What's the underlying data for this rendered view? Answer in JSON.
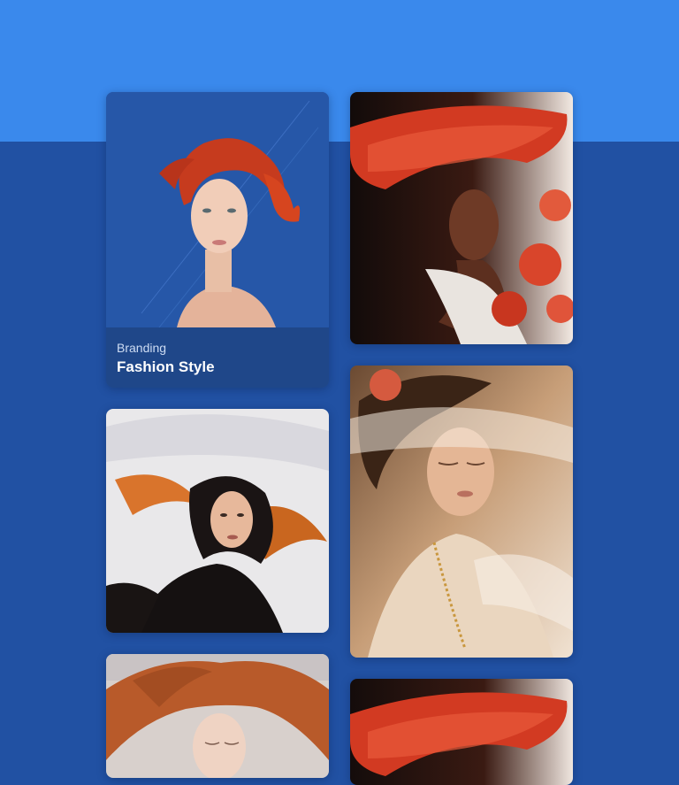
{
  "hero_card": {
    "category": "Branding",
    "title": "Fashion Style"
  },
  "gallery": [
    {
      "subject": "woman with windswept red hair on blue background"
    },
    {
      "subject": "woman in wide red hat holding red roses"
    },
    {
      "subject": "woman with flowing dark hair and white veil"
    },
    {
      "subject": "woman with closed eyes under sheer veil in warm light"
    },
    {
      "subject": "woman with windswept auburn hair"
    },
    {
      "subject": "woman in wide red hat (repeat)"
    }
  ],
  "colors": {
    "band": "#3a89ec",
    "background": "#2151a3",
    "caption": "#1f4789"
  }
}
